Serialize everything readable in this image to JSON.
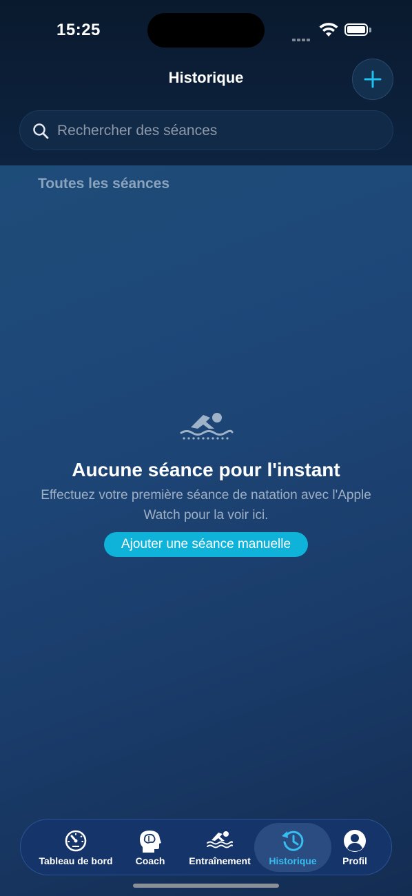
{
  "status_bar": {
    "time": "15:25"
  },
  "header": {
    "title": "Historique"
  },
  "search": {
    "placeholder": "Rechercher des séances"
  },
  "section": {
    "title": "Toutes les séances"
  },
  "empty_state": {
    "icon": "swimmer-icon",
    "title": "Aucune séance pour l'instant",
    "description": "Effectuez votre première séance de natation avec l'Apple Watch pour la voir ici.",
    "button_label": "Ajouter une séance manuelle"
  },
  "tabs": [
    {
      "label": "Tableau de bord",
      "icon": "gauge-icon",
      "active": false
    },
    {
      "label": "Coach",
      "icon": "brain-head-icon",
      "active": false
    },
    {
      "label": "Entraînement",
      "icon": "swimmer-icon",
      "active": false
    },
    {
      "label": "Historique",
      "icon": "history-clock-icon",
      "active": true
    },
    {
      "label": "Profil",
      "icon": "person-circle-icon",
      "active": false
    }
  ],
  "colors": {
    "accent": "#0fb2d8",
    "active_tab": "#38bdf0",
    "plus": "#1ec0ee"
  }
}
